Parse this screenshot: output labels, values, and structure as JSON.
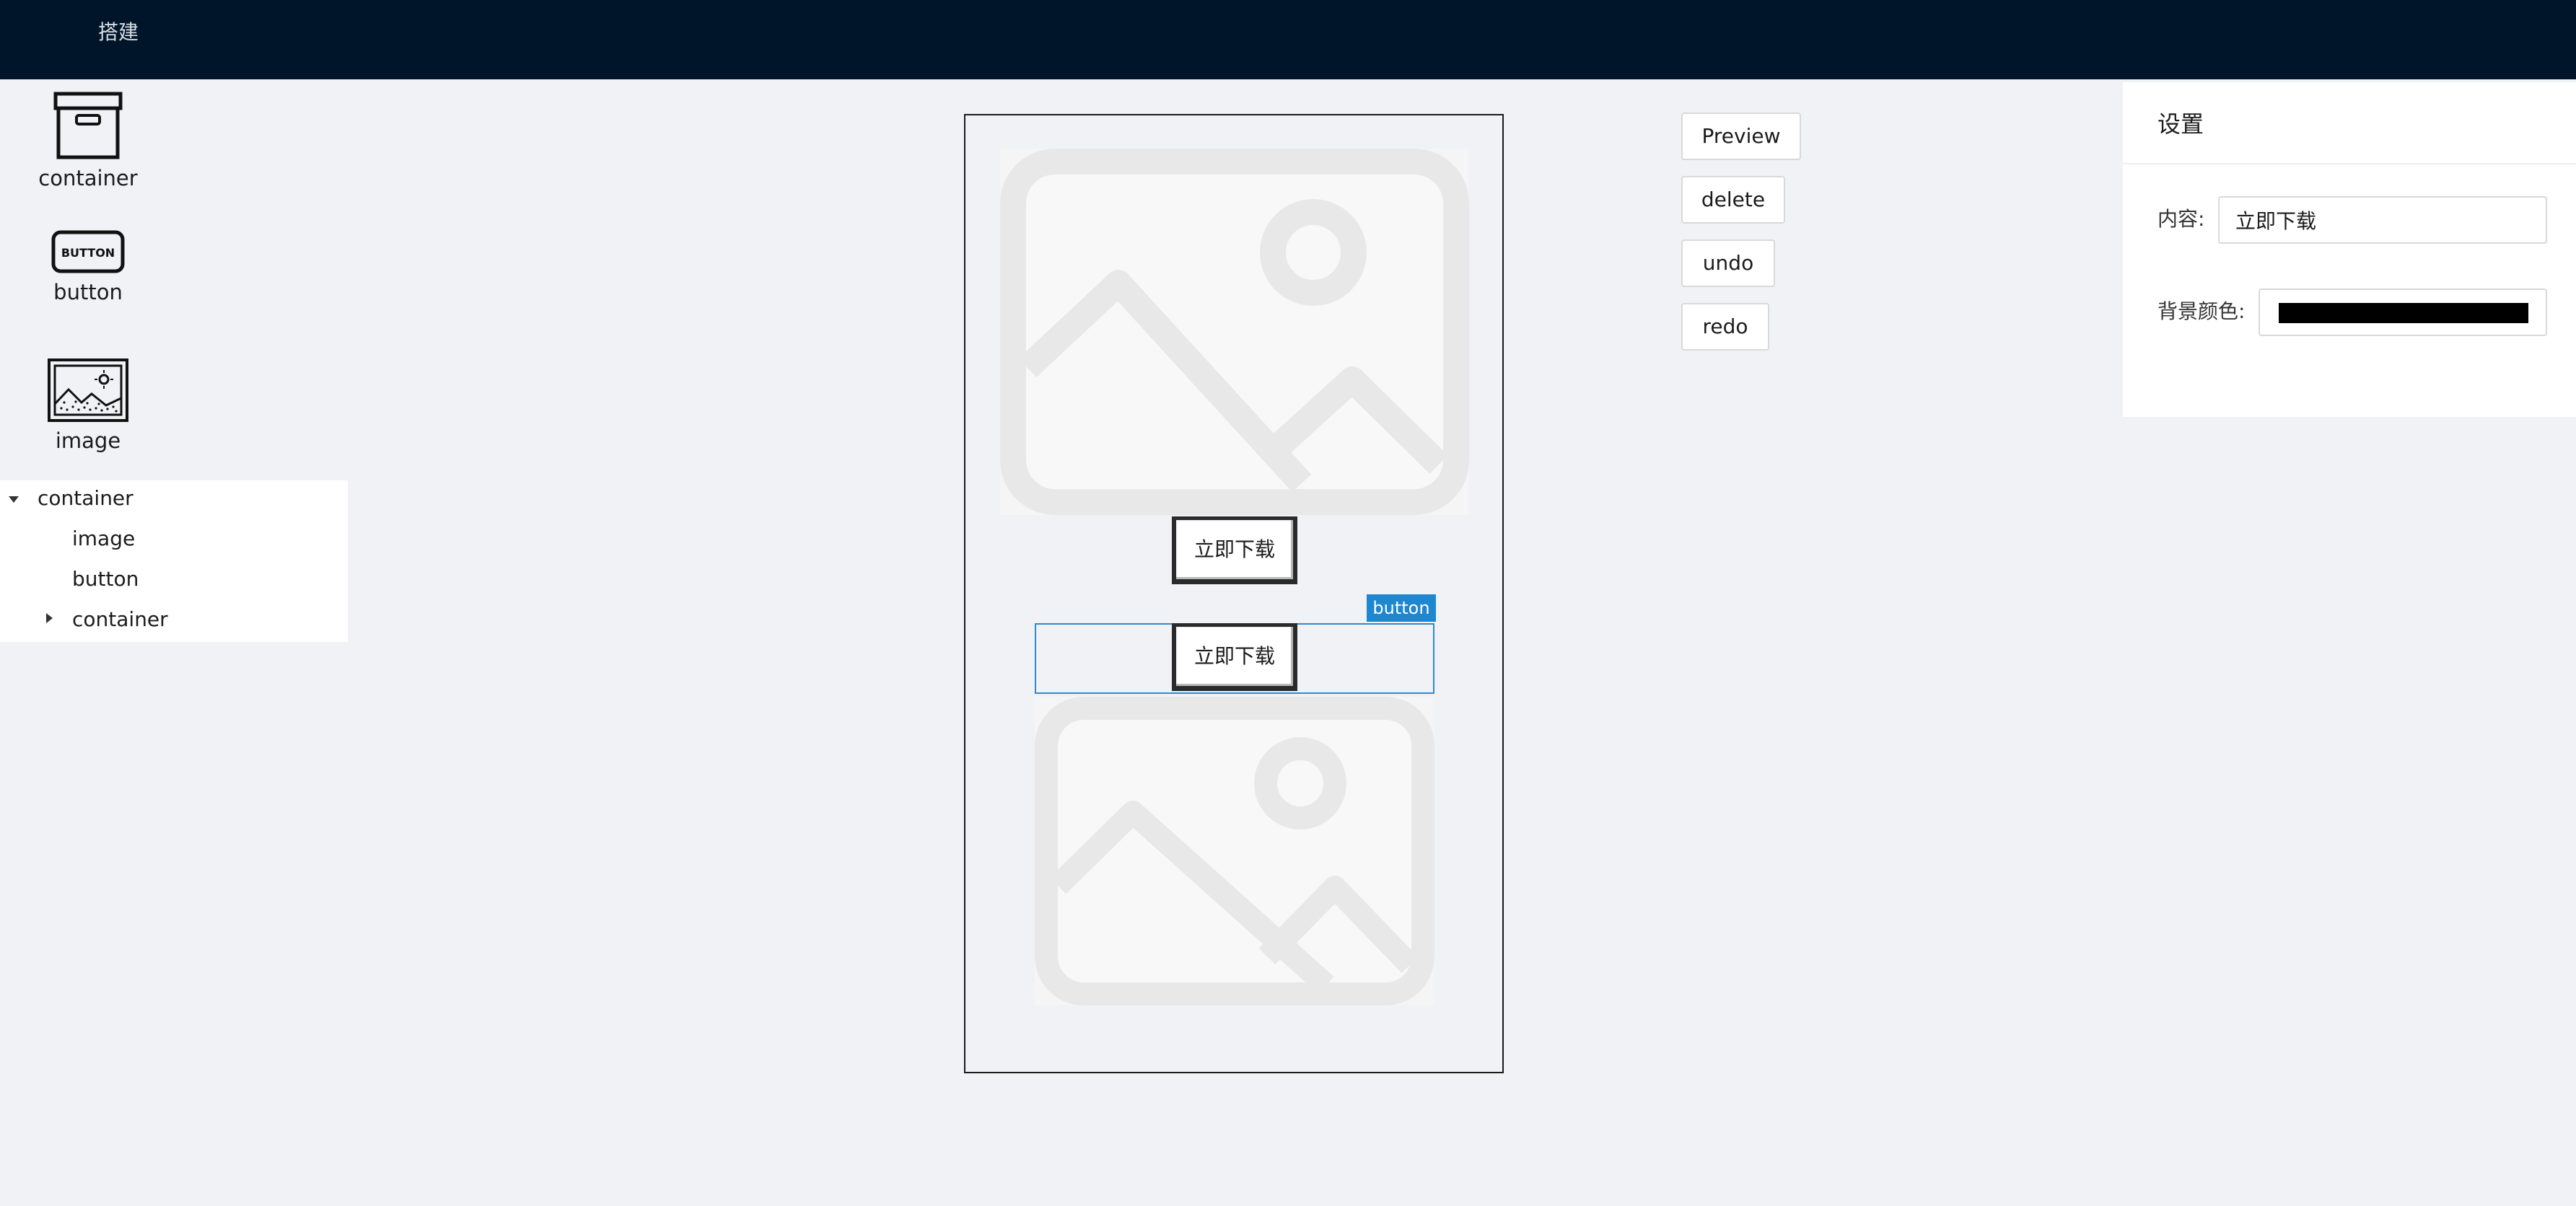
{
  "header": {
    "title": "搭建"
  },
  "palette": {
    "items": [
      {
        "label": "container",
        "icon": "box-icon"
      },
      {
        "label": "button",
        "icon": "button-icon"
      },
      {
        "label": "image",
        "icon": "image-icon"
      }
    ]
  },
  "tree": {
    "root": "container",
    "children": [
      "image",
      "button",
      "container"
    ]
  },
  "canvas": {
    "button_top_label": "立即下载",
    "button_selected_label": "立即下载",
    "selection_tag": "button",
    "image_icon": "image-placeholder-icon"
  },
  "toolbar": {
    "preview": "Preview",
    "delete": "delete",
    "undo": "undo",
    "redo": "redo"
  },
  "settings": {
    "title": "设置",
    "content_label": "内容:",
    "content_value": "立即下载",
    "bg_color_label": "背景颜色:",
    "bg_color_value": "#000000"
  },
  "colors": {
    "header_bg": "#001529",
    "selection": "#1f86d0",
    "page_bg": "#f0f2f5"
  }
}
